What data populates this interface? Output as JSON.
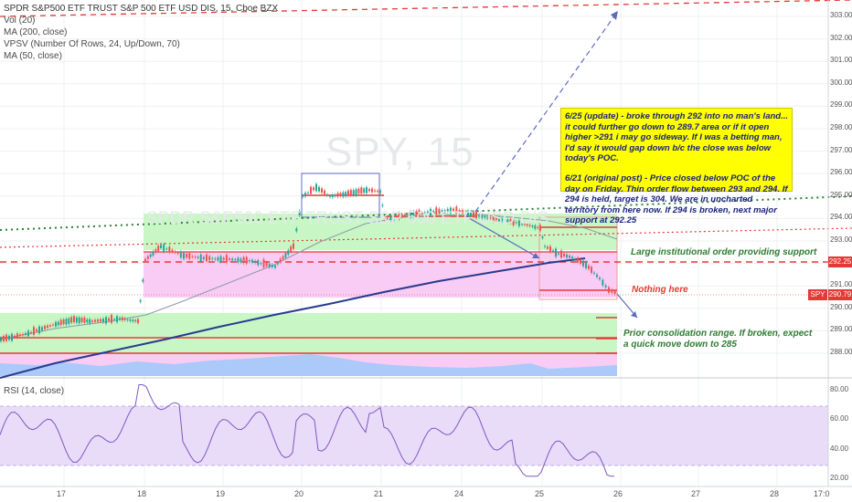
{
  "chart": {
    "symbol_title": "SPDR S&P500 ETF TRUST S&P 500 ETF USD DIS, 15, Cboe BZX",
    "watermark_symbol": "SPY, 15",
    "watermark_name": "SPDR S&P500 ETF TRUST S&P 500 ETF USD DIS",
    "indicators": [
      "Vol (20)",
      "MA (200, close)",
      "VPSV (Number Of Rows, 24, Up/Down, 70)",
      "MA (50, close)"
    ],
    "rsi_legend": "RSI (14, close)",
    "price_axis": [
      "303.00",
      "302.00",
      "301.00",
      "300.00",
      "299.00",
      "298.00",
      "297.00",
      "296.00",
      "295.00",
      "294.00",
      "293.00",
      "292.00",
      "291.00",
      "290.00",
      "289.00",
      "288.00"
    ],
    "rsi_axis": [
      "80.00",
      "60.00",
      "40.00",
      "20.00"
    ],
    "time_axis": [
      "17",
      "18",
      "19",
      "20",
      "21",
      "24",
      "25",
      "26",
      "27",
      "28",
      "17:0"
    ],
    "tags": {
      "level_label": "292.25",
      "symbol_label": "SPY",
      "last_price_label": "290.79"
    },
    "annotations": {
      "note_1": "6/25 (update) - broke through 292 into no man's land... it could further go down to 289.7 area or if it open higher >291 i may go sideway. If I was a betting man, I'd say it would gap down b/c the close was below today's POC.",
      "note_2": "6/21 (original post) - Price closed below POC of the day on Friday. Thin order flow between 293 and 294. If 294 is held, target is 304. We are in uncharted territory from here now. If 294 is broken, next major support at 292.25",
      "large_order": "Large institutional order providing support",
      "nothing_here": "Nothing here",
      "consolidation_1": "Prior consolidation range. If broken, expect",
      "consolidation_2": "a quick move down to 285"
    },
    "colors": {
      "red_line": "#e53935",
      "green_dotted": "#2e7d32",
      "blue_arrow": "#5c6bc0",
      "ma200": "#2a3a8f",
      "rsi_line": "#7e57c2",
      "rsi_band": "#e9dcf8",
      "volume": "#90caf9",
      "up_candle": "#26a69a",
      "down_candle": "#ef5350",
      "box_green": "#c8f7c5",
      "box_pink": "#f9ccf5",
      "note_bg": "#ffff00",
      "note_text": "#1a237e"
    }
  }
}
